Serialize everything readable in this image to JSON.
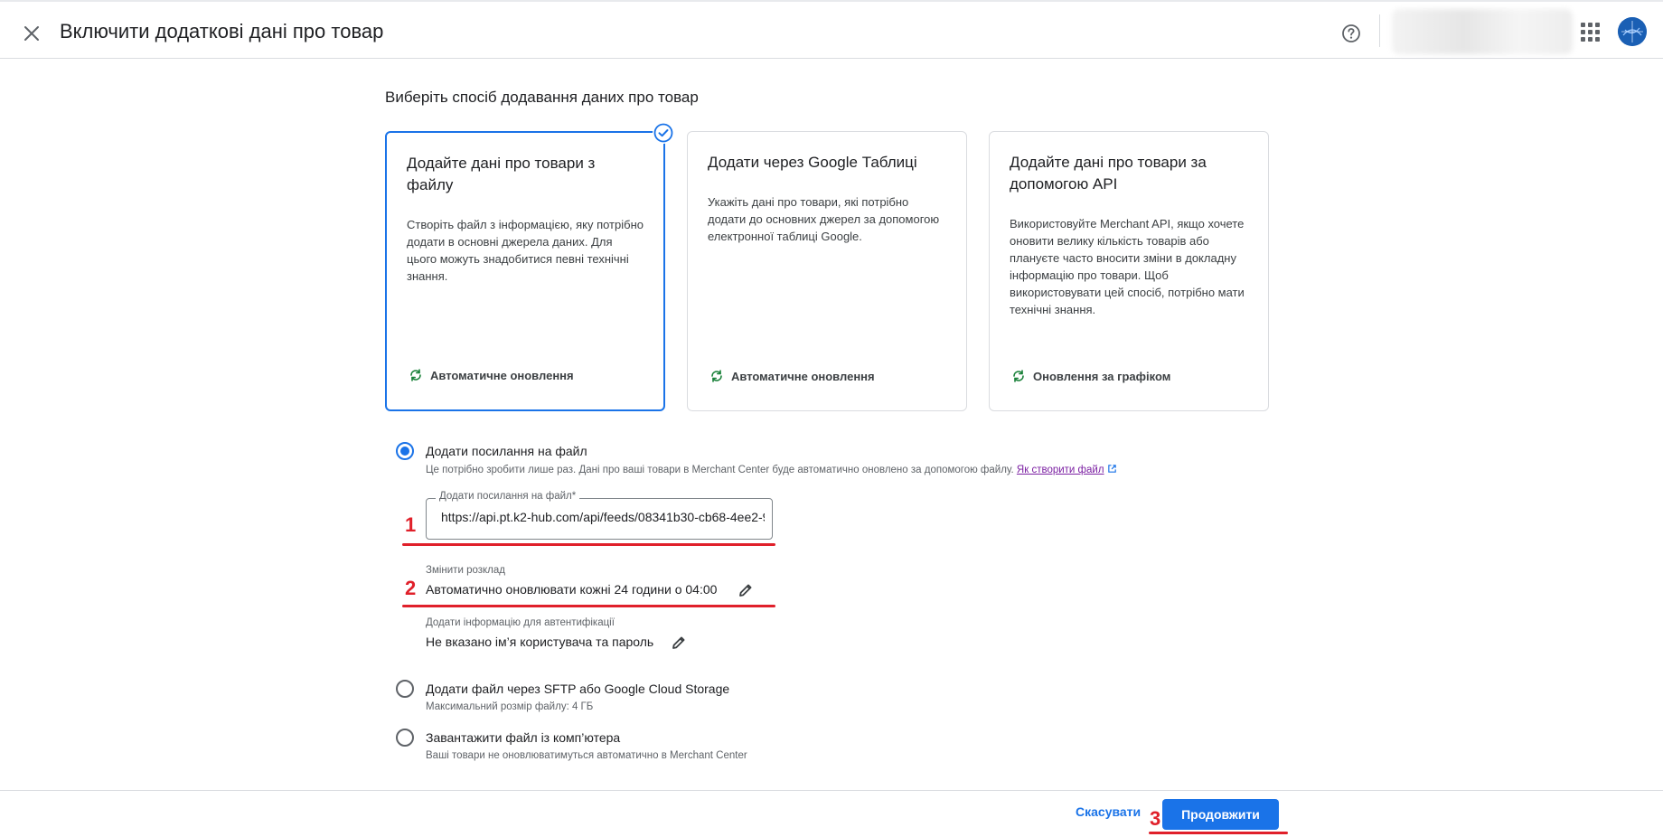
{
  "header": {
    "title": "Включити додаткові дані про товар",
    "close_icon": "close-icon",
    "help_icon": "help-icon",
    "apps_icon": "apps-grid-icon"
  },
  "main": {
    "heading": "Виберіть спосіб додавання даних про товар",
    "cards": [
      {
        "title": "Додайте дані про товари з файлу",
        "description": "Створіть файл з інформацією, яку потрібно додати в основні джерела даних. Для цього можуть знадобитися певні технічні знання.",
        "footer": "Автоматичне оновлення",
        "selected": true
      },
      {
        "title": "Додати через Google Таблиці",
        "description": "Укажіть дані про товари, які потрібно додати до основних джерел за допомогою електронної таблиці Google.",
        "footer": "Автоматичне оновлення",
        "selected": false
      },
      {
        "title": "Додайте дані про товари за допомогою API",
        "description": "Використовуйте Merchant API, якщо хочете оновити велику кількість товарів або плануєте часто вносити зміни в докладну інформацію про товари. Щоб використовувати цей спосіб, потрібно мати технічні знання.",
        "footer": "Оновлення за графіком",
        "selected": false
      }
    ],
    "option_link": {
      "label": "Додати посилання на файл",
      "hint": "Це потрібно зробити лише раз. Дані про ваші товари в Merchant Center буде автоматично оновлено за допомогою файлу.",
      "hint_link": "Як створити файл",
      "field_label": "Додати посилання на файл*",
      "field_value": "https://api.pt.k2-hub.com/api/feeds/08341b30-cb68-4ee2-9",
      "schedule_label": "Змінити розклад",
      "schedule_value": "Автоматично оновлювати кожні 24 години о 04:00",
      "auth_label": "Додати інформацію для автентифікації",
      "auth_value": "Не вказано ім’я користувача та пароль"
    },
    "option_sftp": {
      "label": "Додати файл через SFTP або Google Cloud Storage",
      "hint": "Максимальний розмір файлу: 4 ГБ"
    },
    "option_upload": {
      "label": "Завантажити файл із комп’ютера",
      "hint": "Ваші товари не оновлюватимуться автоматично в Merchant Center"
    }
  },
  "annotations": {
    "n1": "1",
    "n2": "2",
    "n3": "3"
  },
  "footer": {
    "cancel": "Скасувати",
    "continue": "Продовжити"
  },
  "colors": {
    "accent": "#1a73e8",
    "annotation_red": "#e0202a",
    "sync_green": "#188038"
  }
}
